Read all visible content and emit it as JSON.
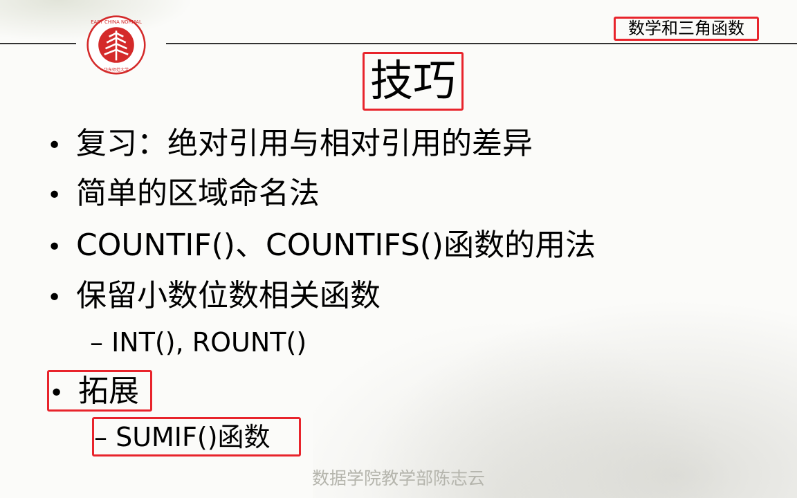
{
  "header": {
    "section_tag": "数学和三角函数",
    "title": "技巧",
    "logo": {
      "text_en": "EAST CHINA NORMAL UNIVERSITY",
      "text_cn": "华东师范大学",
      "color": "#d42a2a"
    }
  },
  "bullets": [
    {
      "text": "复习：绝对引用与相对引用的差异"
    },
    {
      "text": "简单的区域命名法"
    },
    {
      "text": "COUNTIF()、COUNTIFS()函数的用法"
    },
    {
      "text": "保留小数位数相关函数",
      "sub": "– INT(), ROUNT()"
    },
    {
      "text": "拓展",
      "sub": "– SUMIF()函数"
    }
  ],
  "bullet_symbol": "•",
  "footer": "数据学院教学部陈志云",
  "accent_color": "#e8242c"
}
